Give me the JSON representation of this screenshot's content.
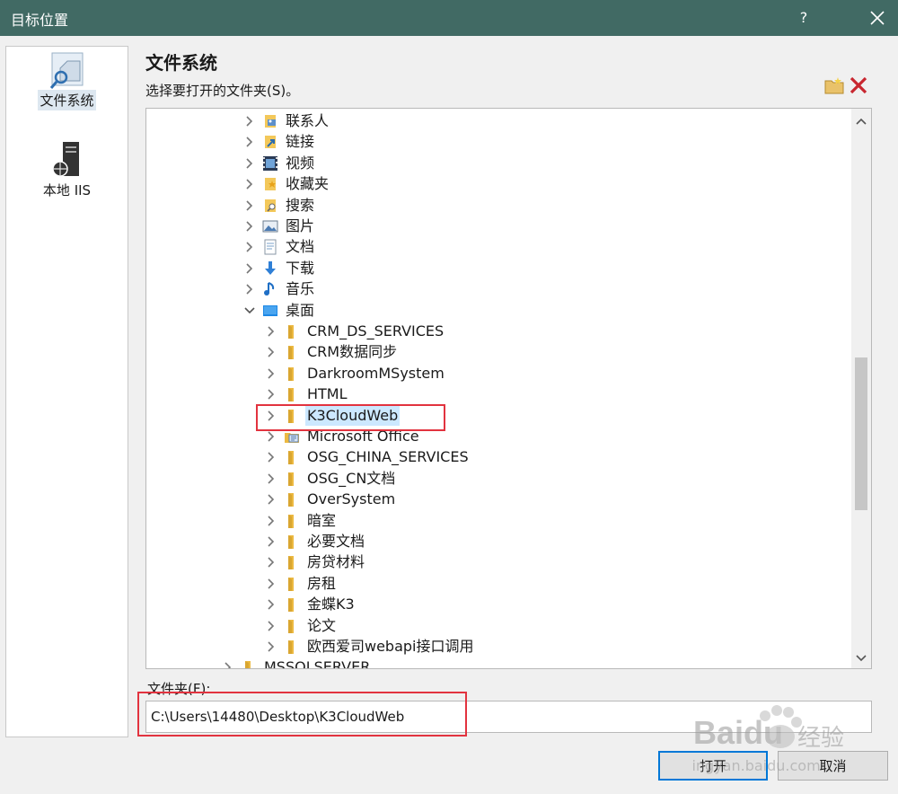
{
  "window": {
    "title": "目标位置",
    "help_label": "?",
    "close_icon": "close-icon"
  },
  "nav": {
    "items": [
      {
        "label": "文件系统",
        "icon": "filesystem-icon",
        "selected": true
      },
      {
        "label": "本地 IIS",
        "icon": "local-iis-icon",
        "selected": false
      }
    ]
  },
  "main": {
    "title": "文件系统",
    "subtitle": "选择要打开的文件夹(S)。",
    "tools": {
      "new_folder_icon": "new-folder-icon",
      "delete_icon": "delete-icon"
    }
  },
  "tree": {
    "rows": [
      {
        "label": "联系人",
        "icon": "contacts-icon",
        "expanded": false,
        "level": 0
      },
      {
        "label": "链接",
        "icon": "links-icon",
        "expanded": false,
        "level": 0
      },
      {
        "label": "视频",
        "icon": "video-icon",
        "expanded": false,
        "level": 0
      },
      {
        "label": "收藏夹",
        "icon": "favorites-icon",
        "expanded": false,
        "level": 0
      },
      {
        "label": "搜索",
        "icon": "search-folder-icon",
        "expanded": false,
        "level": 0
      },
      {
        "label": "图片",
        "icon": "pictures-icon",
        "expanded": false,
        "level": 0
      },
      {
        "label": "文档",
        "icon": "documents-icon",
        "expanded": false,
        "level": 0
      },
      {
        "label": "下载",
        "icon": "downloads-icon",
        "expanded": false,
        "level": 0
      },
      {
        "label": "音乐",
        "icon": "music-icon",
        "expanded": false,
        "level": 0
      },
      {
        "label": "桌面",
        "icon": "desktop-icon",
        "expanded": true,
        "level": 0
      },
      {
        "label": "CRM_DS_SERVICES",
        "icon": "folder-icon",
        "expanded": false,
        "level": 1
      },
      {
        "label": "CRM数据同步",
        "icon": "folder-icon",
        "expanded": false,
        "level": 1
      },
      {
        "label": "DarkroomMSystem",
        "icon": "folder-icon",
        "expanded": false,
        "level": 1
      },
      {
        "label": "HTML",
        "icon": "folder-icon",
        "expanded": false,
        "level": 1
      },
      {
        "label": "K3CloudWeb",
        "icon": "folder-icon",
        "expanded": false,
        "level": 1,
        "selected": true
      },
      {
        "label": "Microsoft Office",
        "icon": "office-folder-icon",
        "expanded": false,
        "level": 1
      },
      {
        "label": "OSG_CHINA_SERVICES",
        "icon": "folder-icon",
        "expanded": false,
        "level": 1
      },
      {
        "label": "OSG_CN文档",
        "icon": "folder-icon",
        "expanded": false,
        "level": 1
      },
      {
        "label": "OverSystem",
        "icon": "folder-icon",
        "expanded": false,
        "level": 1
      },
      {
        "label": "暗室",
        "icon": "folder-icon",
        "expanded": false,
        "level": 1
      },
      {
        "label": "必要文档",
        "icon": "folder-icon",
        "expanded": false,
        "level": 1
      },
      {
        "label": "房贷材料",
        "icon": "folder-icon",
        "expanded": false,
        "level": 1
      },
      {
        "label": "房租",
        "icon": "folder-icon",
        "expanded": false,
        "level": 1
      },
      {
        "label": "金蝶K3",
        "icon": "folder-icon",
        "expanded": false,
        "level": 1
      },
      {
        "label": "论文",
        "icon": "folder-icon",
        "expanded": false,
        "level": 1
      },
      {
        "label": "欧西爱司webapi接口调用",
        "icon": "folder-icon",
        "expanded": false,
        "level": 1
      },
      {
        "label": "MSSQLSERVER",
        "icon": "folder-icon",
        "expanded": false,
        "level": -1
      }
    ]
  },
  "folder": {
    "label": "文件夹(F):",
    "value": "C:\\Users\\14480\\Desktop\\K3CloudWeb"
  },
  "buttons": {
    "open": "打开",
    "cancel": "取消"
  },
  "watermark": {
    "brand": "Baidu",
    "suffix": "经验",
    "url": "jingyan.baidu.com"
  },
  "colors": {
    "titlebar": "#416a64",
    "selection": "#cce8ff",
    "highlight_box": "#e2333f",
    "primary_border": "#0078d7",
    "folder": "#ecb941"
  }
}
